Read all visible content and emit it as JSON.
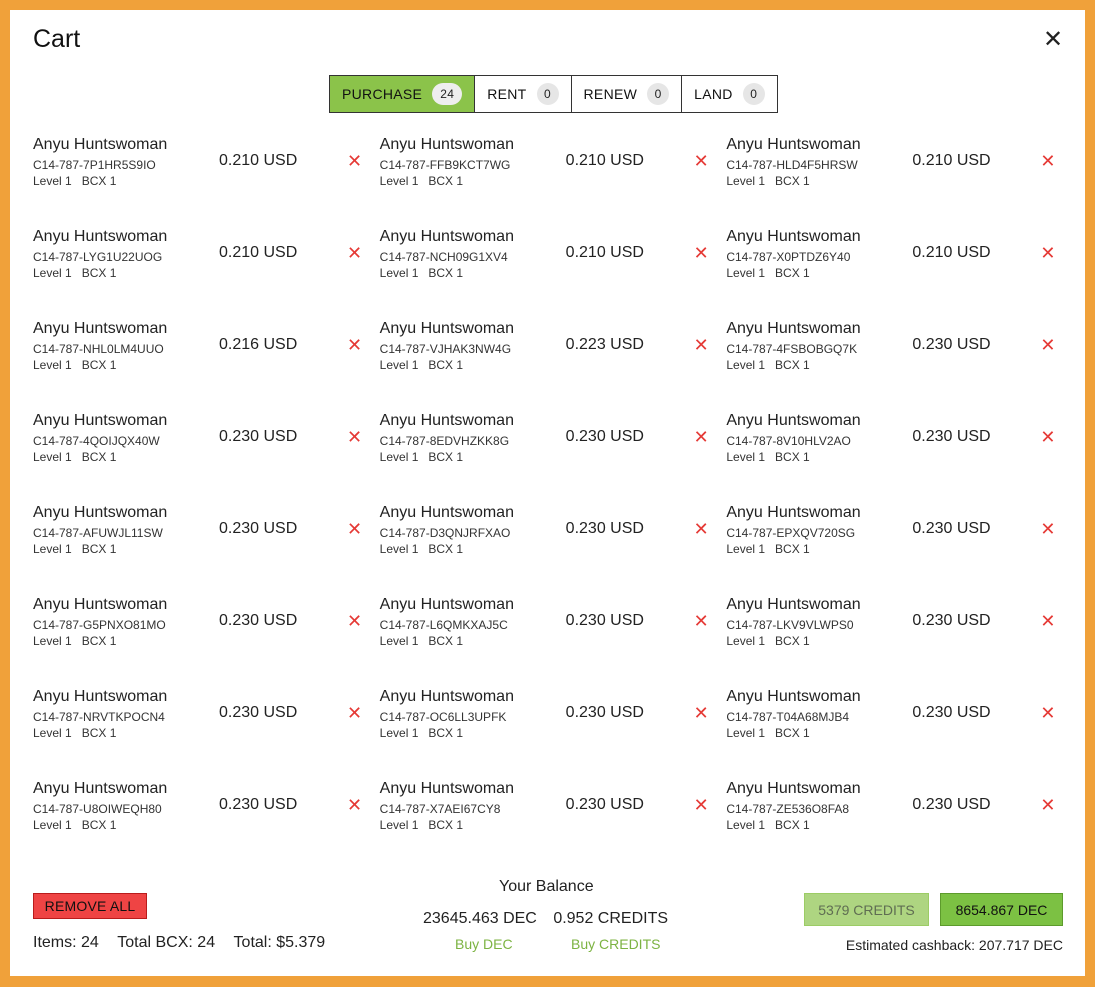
{
  "modal": {
    "title": "Cart",
    "close_icon": "✕"
  },
  "tabs": [
    {
      "label": "PURCHASE",
      "count": "24",
      "active": true
    },
    {
      "label": "RENT",
      "count": "0",
      "active": false
    },
    {
      "label": "RENEW",
      "count": "0",
      "active": false
    },
    {
      "label": "LAND",
      "count": "0",
      "active": false
    }
  ],
  "items": [
    {
      "name": "Anyu Huntswoman",
      "id": "C14-787-7P1HR5S9IO",
      "level": "Level 1",
      "bcx": "BCX 1",
      "price": "0.210 USD"
    },
    {
      "name": "Anyu Huntswoman",
      "id": "C14-787-FFB9KCT7WG",
      "level": "Level 1",
      "bcx": "BCX 1",
      "price": "0.210 USD"
    },
    {
      "name": "Anyu Huntswoman",
      "id": "C14-787-HLD4F5HRSW",
      "level": "Level 1",
      "bcx": "BCX 1",
      "price": "0.210 USD"
    },
    {
      "name": "Anyu Huntswoman",
      "id": "C14-787-LYG1U22UOG",
      "level": "Level 1",
      "bcx": "BCX 1",
      "price": "0.210 USD"
    },
    {
      "name": "Anyu Huntswoman",
      "id": "C14-787-NCH09G1XV4",
      "level": "Level 1",
      "bcx": "BCX 1",
      "price": "0.210 USD"
    },
    {
      "name": "Anyu Huntswoman",
      "id": "C14-787-X0PTDZ6Y40",
      "level": "Level 1",
      "bcx": "BCX 1",
      "price": "0.210 USD"
    },
    {
      "name": "Anyu Huntswoman",
      "id": "C14-787-NHL0LM4UUO",
      "level": "Level 1",
      "bcx": "BCX 1",
      "price": "0.216 USD"
    },
    {
      "name": "Anyu Huntswoman",
      "id": "C14-787-VJHAK3NW4G",
      "level": "Level 1",
      "bcx": "BCX 1",
      "price": "0.223 USD"
    },
    {
      "name": "Anyu Huntswoman",
      "id": "C14-787-4FSBOBGQ7K",
      "level": "Level 1",
      "bcx": "BCX 1",
      "price": "0.230 USD"
    },
    {
      "name": "Anyu Huntswoman",
      "id": "C14-787-4QOIJQX40W",
      "level": "Level 1",
      "bcx": "BCX 1",
      "price": "0.230 USD"
    },
    {
      "name": "Anyu Huntswoman",
      "id": "C14-787-8EDVHZKK8G",
      "level": "Level 1",
      "bcx": "BCX 1",
      "price": "0.230 USD"
    },
    {
      "name": "Anyu Huntswoman",
      "id": "C14-787-8V10HLV2AO",
      "level": "Level 1",
      "bcx": "BCX 1",
      "price": "0.230 USD"
    },
    {
      "name": "Anyu Huntswoman",
      "id": "C14-787-AFUWJL11SW",
      "level": "Level 1",
      "bcx": "BCX 1",
      "price": "0.230 USD"
    },
    {
      "name": "Anyu Huntswoman",
      "id": "C14-787-D3QNJRFXAO",
      "level": "Level 1",
      "bcx": "BCX 1",
      "price": "0.230 USD"
    },
    {
      "name": "Anyu Huntswoman",
      "id": "C14-787-EPXQV720SG",
      "level": "Level 1",
      "bcx": "BCX 1",
      "price": "0.230 USD"
    },
    {
      "name": "Anyu Huntswoman",
      "id": "C14-787-G5PNXO81MO",
      "level": "Level 1",
      "bcx": "BCX 1",
      "price": "0.230 USD"
    },
    {
      "name": "Anyu Huntswoman",
      "id": "C14-787-L6QMKXAJ5C",
      "level": "Level 1",
      "bcx": "BCX 1",
      "price": "0.230 USD"
    },
    {
      "name": "Anyu Huntswoman",
      "id": "C14-787-LKV9VLWPS0",
      "level": "Level 1",
      "bcx": "BCX 1",
      "price": "0.230 USD"
    },
    {
      "name": "Anyu Huntswoman",
      "id": "C14-787-NRVTKPOCN4",
      "level": "Level 1",
      "bcx": "BCX 1",
      "price": "0.230 USD"
    },
    {
      "name": "Anyu Huntswoman",
      "id": "C14-787-OC6LL3UPFK",
      "level": "Level 1",
      "bcx": "BCX 1",
      "price": "0.230 USD"
    },
    {
      "name": "Anyu Huntswoman",
      "id": "C14-787-T04A68MJB4",
      "level": "Level 1",
      "bcx": "BCX 1",
      "price": "0.230 USD"
    },
    {
      "name": "Anyu Huntswoman",
      "id": "C14-787-U8OIWEQH80",
      "level": "Level 1",
      "bcx": "BCX 1",
      "price": "0.230 USD"
    },
    {
      "name": "Anyu Huntswoman",
      "id": "C14-787-X7AEI67CY8",
      "level": "Level 1",
      "bcx": "BCX 1",
      "price": "0.230 USD"
    },
    {
      "name": "Anyu Huntswoman",
      "id": "C14-787-ZE536O8FA8",
      "level": "Level 1",
      "bcx": "BCX 1",
      "price": "0.230 USD"
    }
  ],
  "remove_item_icon": "✕",
  "footer": {
    "remove_all_label": "REMOVE ALL",
    "items_label": "Items: 24",
    "total_bcx_label": "Total BCX: 24",
    "total_label": "Total: $5.379",
    "balance_title": "Your Balance",
    "dec_balance": "23645.463 DEC",
    "credits_balance": "0.952 CREDITS",
    "buy_dec_label": "Buy DEC",
    "buy_credits_label": "Buy CREDITS",
    "pay_credits_label": "5379 CREDITS",
    "pay_dec_label": "8654.867 DEC",
    "cashback_label": "Estimated cashback: 207.717 DEC"
  },
  "colors": {
    "frame": "#f0a13a",
    "accent_green": "#8bc34a",
    "remove_red": "#e53935",
    "link_green": "#7cb342"
  }
}
